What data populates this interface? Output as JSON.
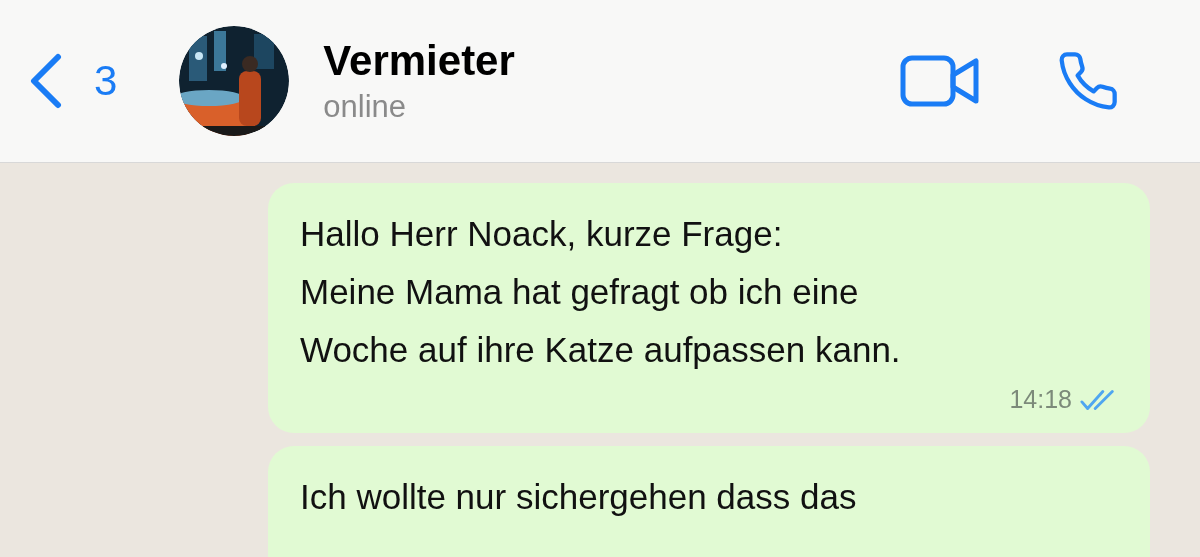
{
  "header": {
    "back_count": "3",
    "title": "Vermieter",
    "status": "online"
  },
  "messages": [
    {
      "lines": [
        "Hallo Herr Noack, kurze Frage:",
        "Meine Mama hat gefragt ob ich eine",
        "Woche auf ihre Katze aufpassen kann."
      ],
      "time": "14:18",
      "read": true
    },
    {
      "lines": [
        "Ich wollte nur sichergehen dass das"
      ]
    }
  ]
}
